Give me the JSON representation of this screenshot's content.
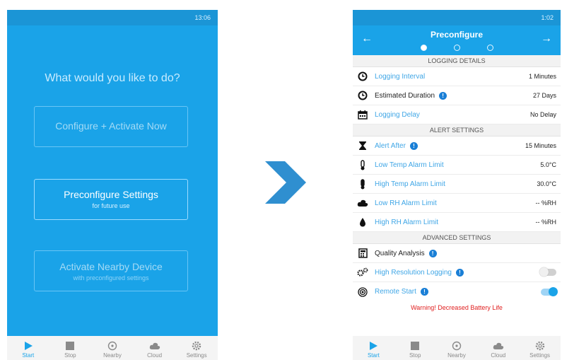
{
  "left": {
    "status_time": "13:06",
    "heading": "What would you like to do?",
    "configure_label": "Configure + Activate Now",
    "preconfigure_label": "Preconfigure Settings",
    "preconfigure_sub": "for future use",
    "nearby_label": "Activate Nearby Device",
    "nearby_sub": "with preconfigured settings",
    "tabs": [
      "Start",
      "Stop",
      "Nearby",
      "Cloud",
      "Settings"
    ]
  },
  "right": {
    "status_time": "1:02",
    "title": "Preconfigure",
    "logging_header": "LOGGING DETAILS",
    "logging_interval_label": "Logging Interval",
    "logging_interval_value": "1 Minutes",
    "estimated_duration_label": "Estimated Duration",
    "estimated_duration_value": "27 Days",
    "logging_delay_label": "Logging Delay",
    "logging_delay_value": "No Delay",
    "alert_header": "ALERT SETTINGS",
    "alert_after_label": "Alert After",
    "alert_after_value": "15 Minutes",
    "low_temp_label": "Low Temp Alarm Limit",
    "low_temp_value": "5.0°C",
    "high_temp_label": "High Temp Alarm Limit",
    "high_temp_value": "30.0°C",
    "low_rh_label": "Low RH Alarm Limit",
    "low_rh_value": "-- %RH",
    "high_rh_label": "High RH Alarm Limit",
    "high_rh_value": "-- %RH",
    "advanced_header": "ADVANCED SETTINGS",
    "quality_label": "Quality Analysis",
    "high_res_label": "High Resolution Logging",
    "high_res_on": false,
    "remote_start_label": "Remote Start",
    "remote_start_on": true,
    "warning": "Warning! Decreased Battery Life",
    "tabs": [
      "Start",
      "Stop",
      "Nearby",
      "Cloud",
      "Settings"
    ]
  },
  "colors": {
    "primary": "#1aa3e8",
    "link": "#3fa6e6",
    "warning": "#e02020",
    "arrow": "#2f8fd0"
  }
}
